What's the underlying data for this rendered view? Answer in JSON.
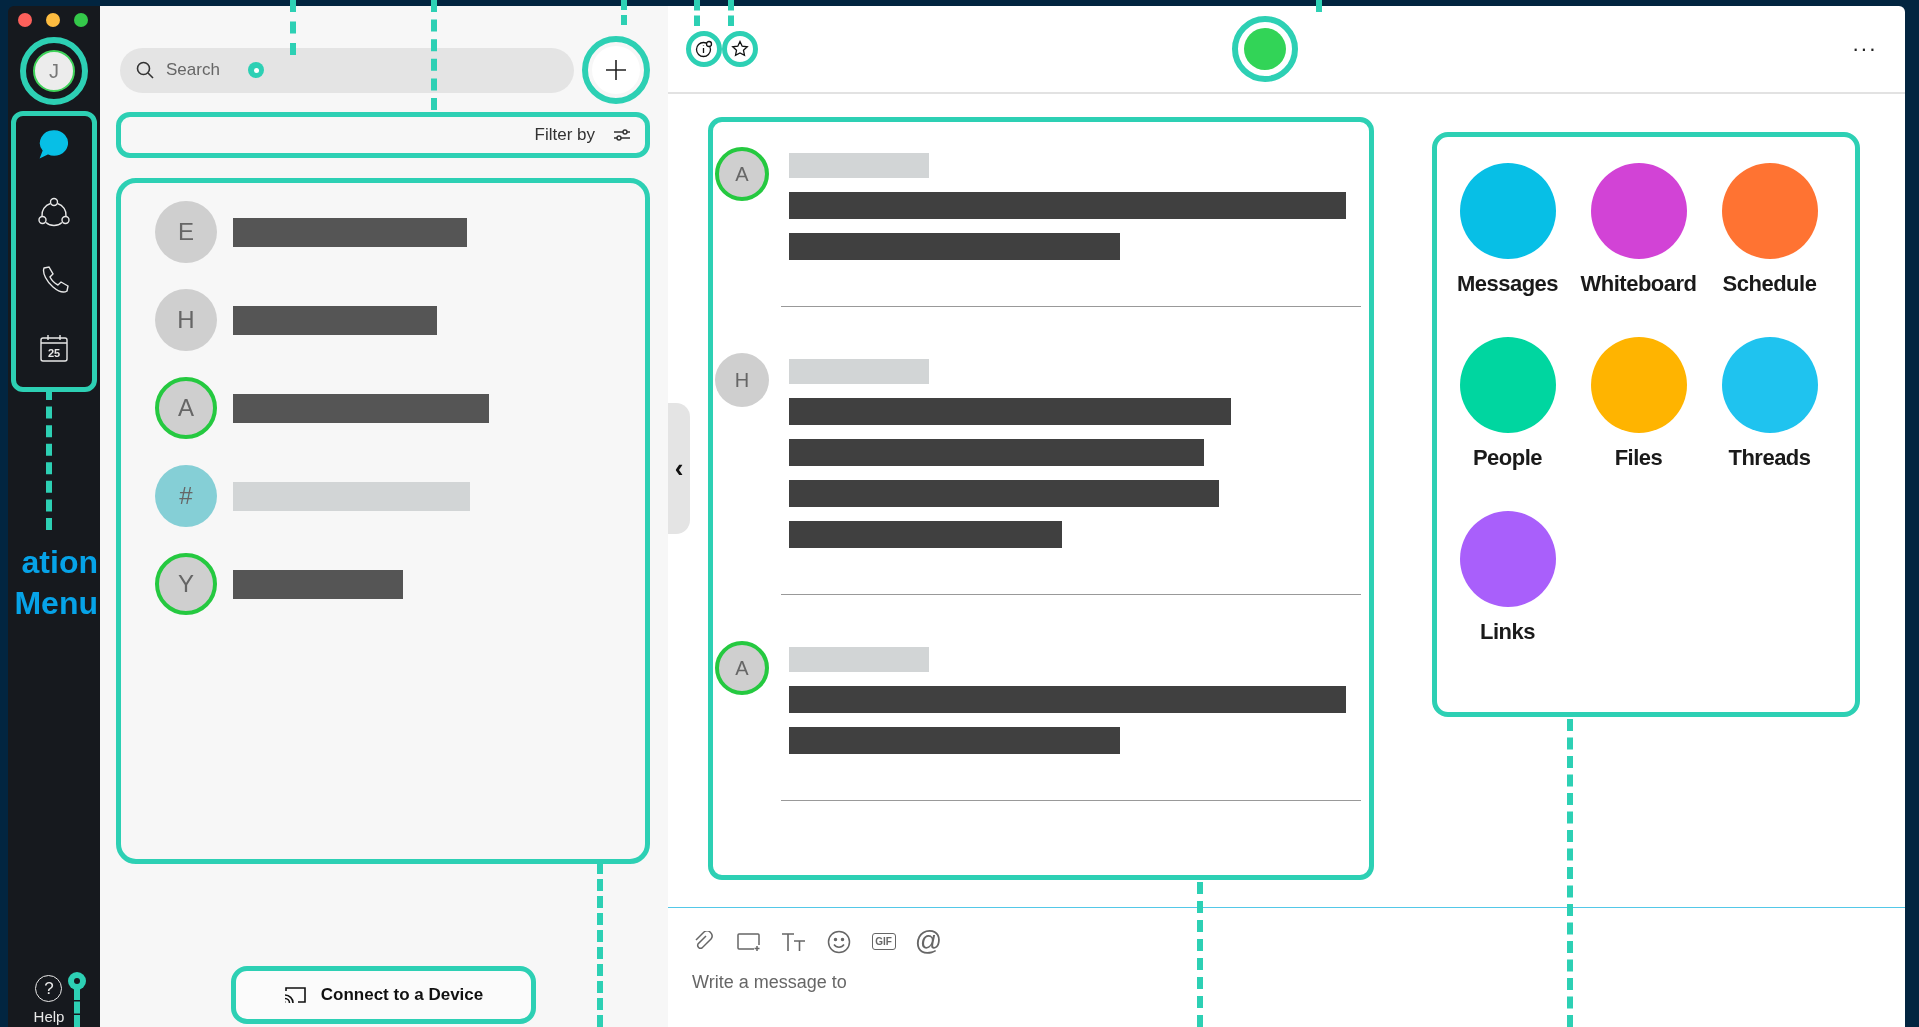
{
  "window_controls": [
    {
      "color": "#fc605b"
    },
    {
      "color": "#fdbc40"
    },
    {
      "color": "#34c84a"
    }
  ],
  "profile": {
    "initial": "J"
  },
  "nav": [
    {
      "kind": "messages",
      "selected": true
    },
    {
      "kind": "teams",
      "selected": false
    },
    {
      "kind": "calls",
      "selected": false
    },
    {
      "kind": "meetings",
      "selected": false,
      "day": "25"
    }
  ],
  "annotation": {
    "text": "ation Menu"
  },
  "help": {
    "icon": "?",
    "label": "Help"
  },
  "search": {
    "placeholder": "Search"
  },
  "filter": {
    "label": "Filter by"
  },
  "conversations": [
    {
      "kind": "person",
      "initial": "E",
      "online": false
    },
    {
      "kind": "person",
      "initial": "H",
      "online": false
    },
    {
      "kind": "person",
      "initial": "A",
      "online": true
    },
    {
      "kind": "space",
      "initial": "#",
      "online": false
    },
    {
      "kind": "person",
      "initial": "Y",
      "online": true
    }
  ],
  "connect_button": {
    "label": "Connect to a Device"
  },
  "collapse_handle": {
    "glyph": "‹"
  },
  "header": {
    "more": "···"
  },
  "messages": [
    {
      "initial": "A",
      "online": true
    },
    {
      "initial": "H",
      "online": false
    },
    {
      "initial": "A",
      "online": true
    }
  ],
  "apps": [
    {
      "label": "Messages",
      "color": "#07bfe6"
    },
    {
      "label": "Whiteboard",
      "color": "#d243d6"
    },
    {
      "label": "Schedule",
      "color": "#ff7332"
    },
    {
      "label": "People",
      "color": "#00d6a0"
    },
    {
      "label": "Files",
      "color": "#ffb400"
    },
    {
      "label": "Threads",
      "color": "#1fc3ef"
    },
    {
      "label": "Links",
      "color": "#a95ffb"
    }
  ],
  "composer": {
    "tools": [
      {
        "kind": "attach"
      },
      {
        "kind": "share"
      },
      {
        "kind": "format"
      },
      {
        "kind": "emoji"
      },
      {
        "kind": "gif",
        "text": "GIF"
      },
      {
        "kind": "mention",
        "text": "@"
      }
    ],
    "placeholder": "Write a message to"
  }
}
